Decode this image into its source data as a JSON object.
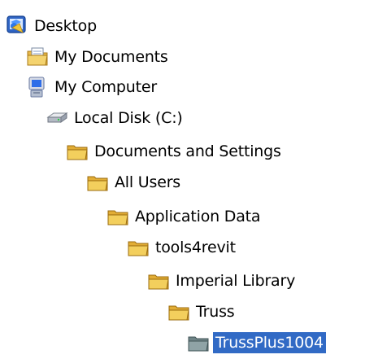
{
  "tree": {
    "items": [
      {
        "label": "Desktop",
        "icon": "desktop-icon",
        "selected": false
      },
      {
        "label": "My Documents",
        "icon": "my-documents-icon",
        "selected": false
      },
      {
        "label": "My Computer",
        "icon": "my-computer-icon",
        "selected": false
      },
      {
        "label": "Local Disk (C:)",
        "icon": "hard-drive-icon",
        "selected": false
      },
      {
        "label": "Documents and Settings",
        "icon": "folder-icon",
        "selected": false
      },
      {
        "label": "All Users",
        "icon": "folder-icon",
        "selected": false
      },
      {
        "label": "Application Data",
        "icon": "folder-icon",
        "selected": false
      },
      {
        "label": "tools4revit",
        "icon": "folder-icon",
        "selected": false
      },
      {
        "label": "Imperial Library",
        "icon": "folder-icon",
        "selected": false
      },
      {
        "label": "Truss",
        "icon": "folder-icon",
        "selected": false
      },
      {
        "label": "TrussPlus1004",
        "icon": "folder-gray-icon",
        "selected": true
      }
    ]
  },
  "colors": {
    "selection_bg": "#316ac5",
    "selection_text": "#ffffff",
    "folder_yellow": "#f3cf5d",
    "folder_gray": "#8fa3a6"
  }
}
